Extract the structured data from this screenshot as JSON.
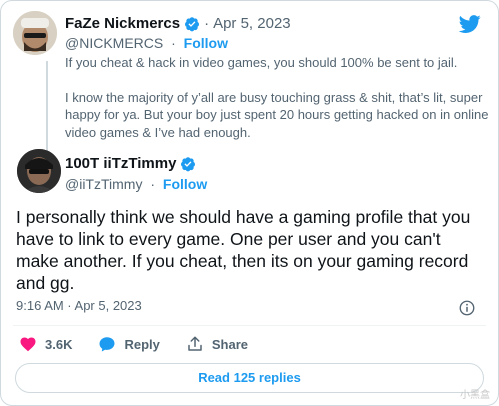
{
  "brand": {
    "accent": "#1d9bf0",
    "verified_color": "#1d9bf0",
    "like_color": "#f91880",
    "icon": "twitter-bird-icon"
  },
  "parent_tweet": {
    "display_name": "FaZe Nickmercs",
    "handle": "@NICKMERCS",
    "separator": "·",
    "date": "Apr 5, 2023",
    "follow_label": "Follow",
    "text_paragraphs": [
      "If you cheat & hack in video games, you should 100% be sent to jail.",
      "I know the majority of y’all are busy touching grass & shit, that’s lit, super happy for ya. But your boy just spent 20 hours getting hacked on in online video games & I’ve had enough."
    ]
  },
  "main_tweet": {
    "display_name": "100T iiTzTimmy",
    "handle": "@iiTzTimmy",
    "separator": "·",
    "follow_label": "Follow",
    "text": "I personally think we should have a gaming profile that you have to link to every game. One per user and you can't make another. If you cheat, then its on your gaming record and gg.",
    "timestamp": "9:16 AM · Apr 5, 2023"
  },
  "actions": {
    "likes": "3.6K",
    "reply_label": "Reply",
    "share_label": "Share"
  },
  "read_replies_label": "Read 125 replies",
  "watermark": "小黑盒"
}
